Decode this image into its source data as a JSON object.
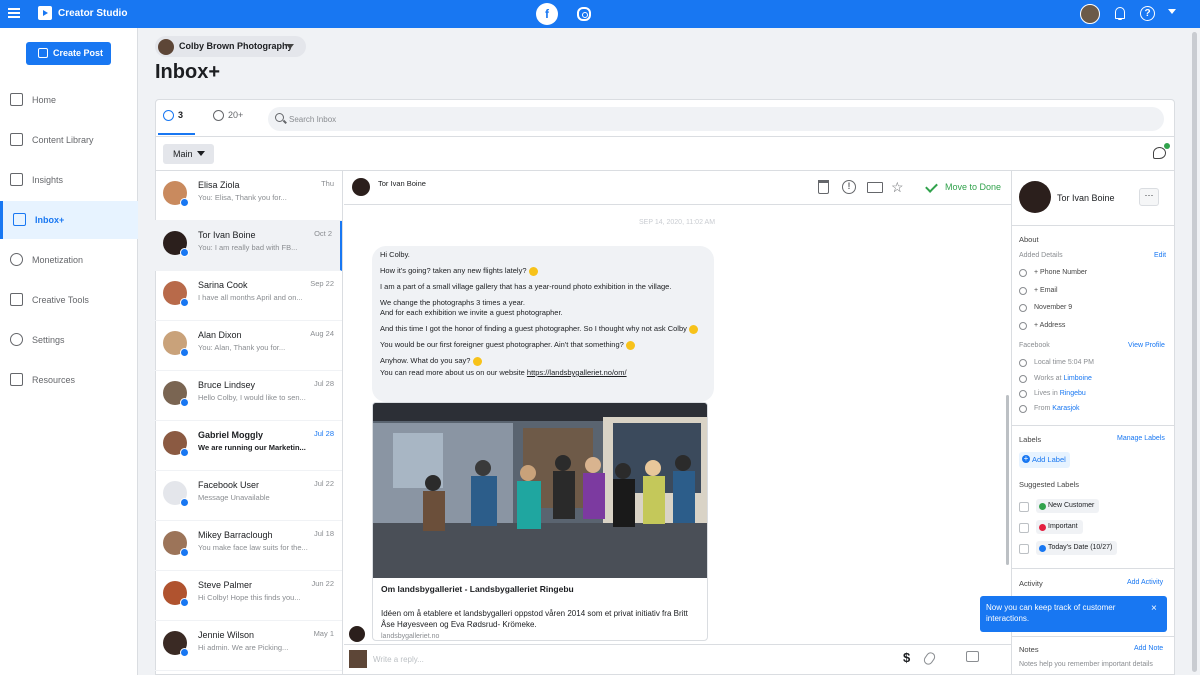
{
  "topbar": {
    "app_title": "Creator Studio",
    "platforms": [
      "facebook-icon",
      "instagram-icon"
    ],
    "help": "?"
  },
  "sidebar": {
    "create_label": "Create Post",
    "items": [
      {
        "label": "Home",
        "icon": "home-icon"
      },
      {
        "label": "Content Library",
        "icon": "library-icon"
      },
      {
        "label": "Insights",
        "icon": "insights-icon"
      },
      {
        "label": "Inbox+",
        "icon": "inbox-icon",
        "active": true
      },
      {
        "label": "Monetization",
        "icon": "dollar-icon"
      },
      {
        "label": "Creative Tools",
        "icon": "tools-icon"
      },
      {
        "label": "Settings",
        "icon": "gear-icon"
      },
      {
        "label": "Resources",
        "icon": "resources-icon"
      }
    ]
  },
  "page": {
    "selector": "Colby Brown Photography",
    "heading": "Inbox+"
  },
  "tabs": {
    "messenger_count": "3",
    "comments_count": "20+"
  },
  "search": {
    "placeholder": "Search Inbox"
  },
  "filter": {
    "label": "Main"
  },
  "conversations": [
    {
      "name": "Elisa Ziola",
      "preview": "You: Elisa, Thank you for...",
      "date": "Thu",
      "bold": false,
      "avatar": "#c98a5e"
    },
    {
      "name": "Tor Ivan Boine",
      "preview": "You: I am really bad with FB...",
      "date": "Oct 2",
      "bold": false,
      "avatar": "#2b1f1c"
    },
    {
      "name": "Sarina Cook",
      "preview": "I have all months April and on...",
      "date": "Sep 22",
      "bold": false,
      "avatar": "#b86a4a"
    },
    {
      "name": "Alan Dixon",
      "preview": "You: Alan, Thank you for...",
      "date": "Aug 24",
      "bold": false,
      "avatar": "#c9a27a"
    },
    {
      "name": "Bruce Lindsey",
      "preview": "Hello Colby, I would like to sen...",
      "date": "Jul 28",
      "bold": false,
      "avatar": "#7a6552"
    },
    {
      "name": "Gabriel Moggly",
      "preview": "We are running our Marketin...",
      "date": "Jul 28",
      "bold": true,
      "avatar": "#8b5a42"
    },
    {
      "name": "Facebook User",
      "preview": "Message Unavailable",
      "date": "Jul 22",
      "bold": false,
      "avatar": "#e4e6eb"
    },
    {
      "name": "Mikey Barraclough",
      "preview": "You make face law suits for the...",
      "date": "Jul 18",
      "bold": false,
      "avatar": "#9c7459"
    },
    {
      "name": "Steve Palmer",
      "preview": "Hi Colby! Hope this finds you...",
      "date": "Jun 22",
      "bold": false,
      "avatar": "#b0532f"
    },
    {
      "name": "Jennie Wilson",
      "preview": "Hi admin. We are Picking...",
      "date": "May 1",
      "bold": false,
      "avatar": "#3a2a24"
    }
  ],
  "thread": {
    "name": "Tor Ivan Boine",
    "done_label": "Move to Done",
    "timestamp": "SEP 14, 2020, 11:02 AM",
    "messages": [
      "Hi Colby.",
      "How it's going? taken any new flights lately?",
      "I am a part of a small village gallery that has a year-round photo exhibition in the village.",
      "We change the photographs 3 times a year.",
      "And for each exhibition we invite a guest photographer.",
      "And this time I got the honor of finding a guest photographer. So I thought why not ask Colby",
      "You would be our first foreigner guest photographer. Ain't that something?",
      "Anyhow. What do you say?",
      "You can read more about us on our website",
      "https://landsbygalleriet.no/om/"
    ],
    "link_card": {
      "title": "Om landsbygalleriet - Landsbygalleriet Ringebu",
      "description": "Idéen om å etablere et landsbygalleri oppstod våren 2014 som et privat initiativ fra Britt Åse Høyesveen og Eva Rødsrud- Krömeke.",
      "domain": "landsbygalleriet.no"
    },
    "reply_placeholder": "Write a reply..."
  },
  "profile": {
    "name": "Tor Ivan Boine",
    "more": "···",
    "about": "About",
    "added_details": "Added Details",
    "edit": "Edit",
    "phone": "+ Phone Number",
    "email": "+ Email",
    "birthday": "November 9",
    "address": "+ Address",
    "facebook": "Facebook",
    "view_profile": "View Profile",
    "local_time": "Local time 5:04 PM",
    "works_at_prefix": "Works at",
    "works_at": "Limboine",
    "lives_in_prefix": "Lives in",
    "lives_in": "Ringebu",
    "from_prefix": "From",
    "from": "Karasjok",
    "labels": "Labels",
    "manage_labels": "Manage Labels",
    "add_label": "Add Label",
    "suggested": "Suggested Labels",
    "suggestions": [
      {
        "label": "New Customer",
        "color": "#31a24c"
      },
      {
        "label": "Important",
        "color": "#e41e3f"
      },
      {
        "label": "Today's Date (10/27)",
        "color": "#1877f2"
      }
    ],
    "activity": "Activity",
    "add_activity": "Add Activity",
    "notes": "Notes",
    "add_note": "Add Note",
    "notes_help": "Notes help you remember important details"
  },
  "tooltip": {
    "text": "Now you can keep track of customer interactions.",
    "close": "×"
  }
}
